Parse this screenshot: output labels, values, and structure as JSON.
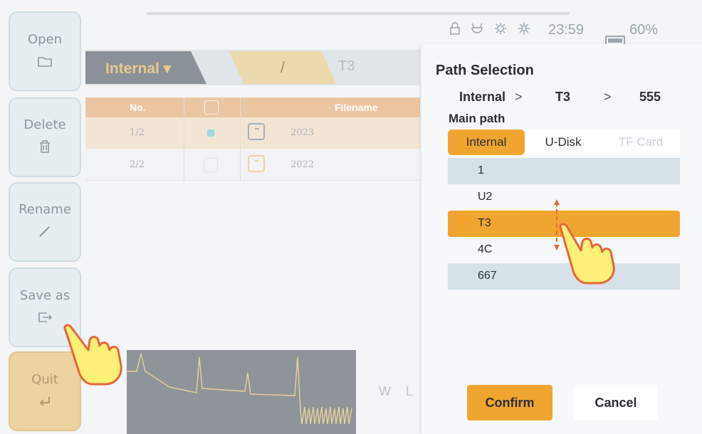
{
  "sidebar": {
    "items": [
      {
        "label": "Open",
        "icon": "folder-icon"
      },
      {
        "label": "Delete",
        "icon": "trash-icon"
      },
      {
        "label": "Rename",
        "icon": "pencil-icon"
      },
      {
        "label": "Save as",
        "icon": "save-as-icon"
      },
      {
        "label": "Quit",
        "icon": "return-arrow-icon"
      }
    ]
  },
  "status": {
    "time": "23:59",
    "battery": "60%"
  },
  "tabs": {
    "storage": "Internal ▾",
    "path": "/",
    "folder": "T3"
  },
  "table": {
    "headers": [
      "No.",
      "Filename"
    ],
    "rows": [
      {
        "no": "1/2",
        "name": "2023",
        "checked": true
      },
      {
        "no": "2/2",
        "name": "2022",
        "checked": false
      }
    ]
  },
  "bottom": {
    "wl": "W L"
  },
  "dialog": {
    "title": "Path Selection",
    "breadcrumb": [
      "Internal",
      ">",
      "T3",
      ">",
      "555"
    ],
    "main_path_label": "Main path",
    "devices": [
      "Internal",
      "U-Disk",
      "TF Card"
    ],
    "paths": [
      "1",
      "U2",
      "T3",
      "4C",
      "667"
    ],
    "selected_path": "T3",
    "confirm": "Confirm",
    "cancel": "Cancel"
  },
  "colors": {
    "accent": "#f1a531",
    "scroll_arrow": "#e8663a"
  }
}
